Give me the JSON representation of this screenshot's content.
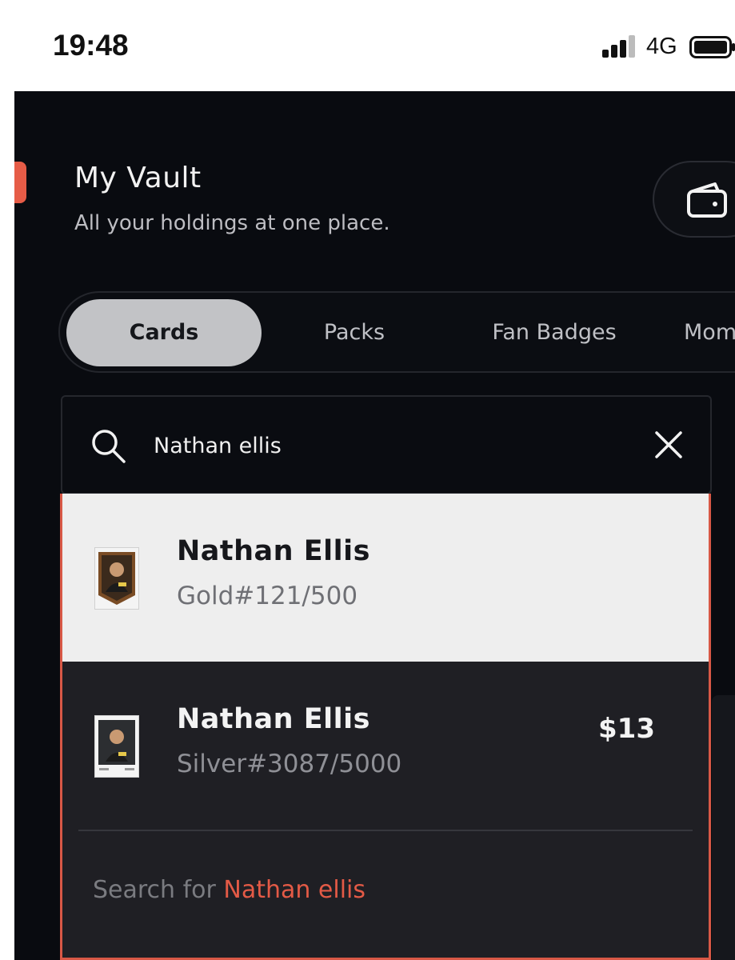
{
  "status_bar": {
    "time": "19:48",
    "network": "4G",
    "signal_bars": 3
  },
  "header": {
    "title": "My Vault",
    "subtitle": "All your holdings at one place.",
    "wallet_icon": "wallet-icon"
  },
  "tabs": [
    {
      "label": "Cards",
      "active": true
    },
    {
      "label": "Packs",
      "active": false
    },
    {
      "label": "Fan Badges",
      "active": false
    },
    {
      "label": "Mom",
      "active": false
    }
  ],
  "search": {
    "value": "Nathan ellis",
    "search_icon": "search-icon",
    "clear_icon": "close-icon"
  },
  "results": [
    {
      "name": "Nathan Ellis",
      "edition": "Gold#121/500",
      "price": "",
      "highlighted": true,
      "tier_color": "#8a5a2e"
    },
    {
      "name": "Nathan Ellis",
      "edition": "Silver#3087/5000",
      "price": "$13",
      "highlighted": false,
      "tier_color": "#3a3c40"
    }
  ],
  "search_for": {
    "prefix": "Search for ",
    "query": "Nathan ellis"
  },
  "colors": {
    "accent": "#e35a46",
    "background": "#090b10",
    "active_tab": "#c2c3c6"
  }
}
